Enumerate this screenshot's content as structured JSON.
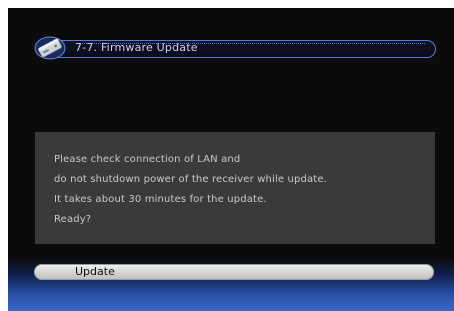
{
  "header": {
    "icon": "satellite-receiver-icon",
    "title": "7-7.  Firmware Update"
  },
  "message": {
    "lines": [
      "Please check connection of LAN and",
      "do not shutdown power of the receiver while update.",
      "It takes about 30 minutes for the update.",
      "Ready?"
    ]
  },
  "actions": {
    "update_label": "Update"
  },
  "colors": {
    "screen_background": "#0b0b0c",
    "title_border": "#5a78d8",
    "title_text": "#c8d0f4",
    "panel_background": "#3a3a3b",
    "panel_text": "#c9c9c9",
    "band_blue": "#3a66c6",
    "button_face": "#d4d4d4"
  }
}
